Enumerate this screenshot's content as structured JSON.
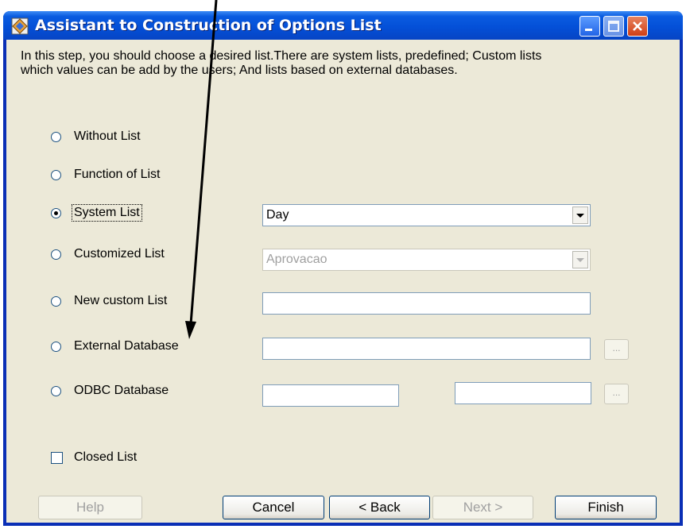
{
  "window": {
    "title": "Assistant to Construction of Options List"
  },
  "description": "In this step, you should choose a desired list.There are system lists, predefined; Custom lists which values can be add by the users; And lists based on external databases.",
  "options": {
    "without_list": "Without List",
    "function_of_list": "Function of List",
    "system_list": "System List",
    "customized_list": "Customized List",
    "new_custom_list": "New custom List",
    "external_database": "External Database",
    "odbc_database": "ODBC Database",
    "selected": "System List"
  },
  "fields": {
    "system_list_value": "Day",
    "customized_list_value": "Aprovacao",
    "new_custom_list_value": "",
    "external_database_value": "",
    "odbc_value_1": "",
    "odbc_value_2": "",
    "browse_label": "..."
  },
  "closed_list": {
    "label": "Closed List",
    "checked": false
  },
  "buttons": {
    "help": "Help",
    "cancel": "Cancel",
    "back": "< Back",
    "next": "Next >",
    "finish": "Finish"
  },
  "colors": {
    "titlebar": "#0450d8",
    "dialog_bg": "#ece9d8",
    "close_button": "#cf3f16"
  }
}
